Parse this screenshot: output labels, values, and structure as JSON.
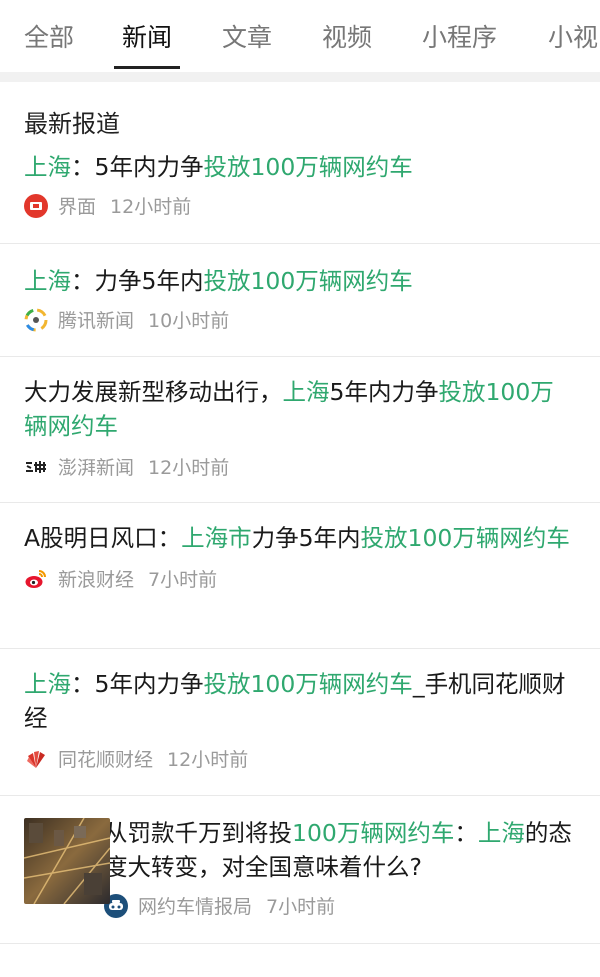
{
  "tabs": [
    {
      "label": "全部"
    },
    {
      "label": "新闻"
    },
    {
      "label": "文章"
    },
    {
      "label": "视频"
    },
    {
      "label": "小程序"
    },
    {
      "label": "小视"
    }
  ],
  "section_title": "最新报道",
  "colors": {
    "highlight": "#2fa86f",
    "meta": "#9a9a9a"
  },
  "articles": [
    {
      "parts": [
        [
          "上海",
          true
        ],
        [
          "：5年内力争",
          false
        ],
        [
          "投放100万辆网约车",
          true
        ]
      ],
      "source": "界面",
      "time": "12小时前",
      "icon": "jiemian-logo-icon"
    },
    {
      "parts": [
        [
          "上海",
          true
        ],
        [
          "：力争5年内",
          false
        ],
        [
          "投放100万辆网约车",
          true
        ]
      ],
      "source": "腾讯新闻",
      "time": "10小时前",
      "icon": "tencent-news-logo-icon"
    },
    {
      "parts": [
        [
          "大力发展新型移动出行，",
          false
        ],
        [
          "上海",
          true
        ],
        [
          "5年内力争",
          false
        ],
        [
          "投放100万辆网约车",
          true
        ]
      ],
      "source": "澎湃新闻",
      "time": "12小时前",
      "icon": "thepaper-logo-icon"
    },
    {
      "parts": [
        [
          "A股明日风口：",
          false
        ],
        [
          "上海市",
          true
        ],
        [
          "力争5年内",
          false
        ],
        [
          "投放100万辆网约车",
          true
        ]
      ],
      "source": "新浪财经",
      "time": "7小时前",
      "icon": "weibo-logo-icon"
    },
    {
      "parts": [
        [
          "上海",
          true
        ],
        [
          "：5年内力争",
          false
        ],
        [
          "投放100万辆网约车",
          true
        ],
        [
          "_手机同花顺财经",
          false
        ]
      ],
      "source": "同花顺财经",
      "time": "12小时前",
      "icon": "tonghuashun-logo-icon"
    },
    {
      "parts": [
        [
          "从罚款千万到将投",
          false
        ],
        [
          "100万辆网约车",
          true
        ],
        [
          "：",
          false
        ],
        [
          "上海",
          true
        ],
        [
          "的态度大转变，对全国意味着什么?",
          false
        ]
      ],
      "source": "网约车情报局",
      "time": "7小时前",
      "icon": "wangyueche-logo-icon",
      "has_thumbnail": true
    }
  ]
}
